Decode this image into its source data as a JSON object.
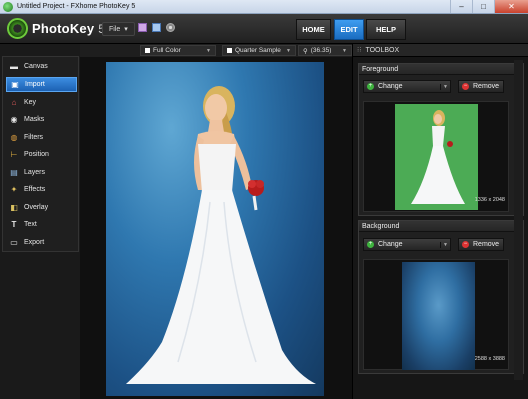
{
  "window": {
    "title": "Untitled Project - FXhome PhotoKey 5",
    "min": "–",
    "max": "□",
    "close": "✕"
  },
  "header": {
    "logo_name": "PhotoKey",
    "logo_version": "5",
    "file_menu": "File",
    "file_menu_arrow": "▾",
    "modes": [
      {
        "label": "HOME"
      },
      {
        "label": "EDIT"
      },
      {
        "label": "HELP"
      }
    ],
    "active_mode": "EDIT"
  },
  "options": {
    "color_mode": "Full Color",
    "quality": "Quarter Sample",
    "zoom": "(36.35)"
  },
  "sidebar": {
    "items": [
      {
        "label": "Canvas",
        "icon": "canvas-icon",
        "glyph": "▬"
      },
      {
        "label": "Import",
        "icon": "import-icon",
        "glyph": "▣"
      },
      {
        "label": "Key",
        "icon": "key-icon",
        "glyph": "⌂"
      },
      {
        "label": "Masks",
        "icon": "masks-icon",
        "glyph": "◉"
      },
      {
        "label": "Filters",
        "icon": "filters-icon",
        "glyph": "◍"
      },
      {
        "label": "Position",
        "icon": "position-icon",
        "glyph": "⊢"
      },
      {
        "label": "Layers",
        "icon": "layers-icon",
        "glyph": "▤"
      },
      {
        "label": "Effects",
        "icon": "effects-icon",
        "glyph": "✦"
      },
      {
        "label": "Overlay",
        "icon": "overlay-icon",
        "glyph": "◧"
      },
      {
        "label": "Text",
        "icon": "text-icon",
        "glyph": "T"
      },
      {
        "label": "Export",
        "icon": "export-icon",
        "glyph": "▭"
      }
    ],
    "active": "Import"
  },
  "toolbox": {
    "title": "TOOLBOX",
    "grip": "⁝⁝",
    "foreground": {
      "title": "Foreground",
      "change_label": "Change",
      "remove_label": "Remove",
      "dimensions": "1336 x 2048"
    },
    "background": {
      "title": "Background",
      "change_label": "Change",
      "remove_label": "Remove",
      "dimensions": "2588 x 3888"
    }
  },
  "colors": {
    "accent": "#2a7fd4",
    "fg_green": "#4cab55",
    "remove_red": "#d33333",
    "add_green": "#3fb43f"
  }
}
